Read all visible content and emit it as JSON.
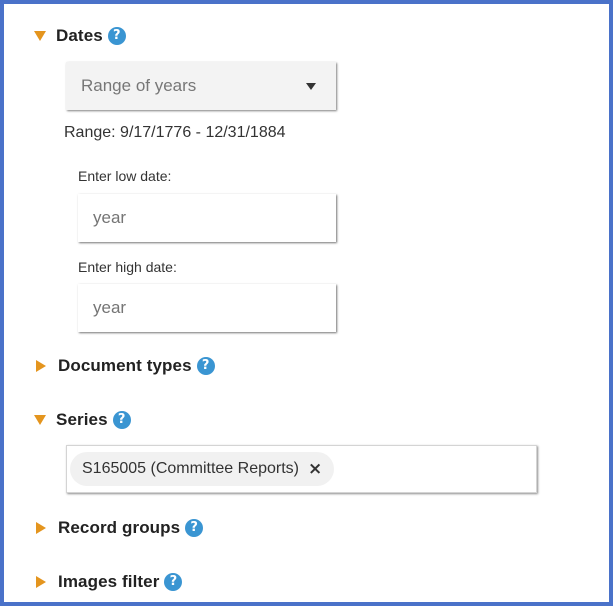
{
  "dates": {
    "title": "Dates",
    "range_select": {
      "value": "Range of years"
    },
    "range_text": "Range: 9/17/1776 - 12/31/1884",
    "low": {
      "label": "Enter low date:",
      "placeholder": "year"
    },
    "high": {
      "label": "Enter high date:",
      "placeholder": "year"
    }
  },
  "document_types": {
    "title": "Document types"
  },
  "series": {
    "title": "Series",
    "chip_label": "S165005 (Committee Reports)",
    "chip_remove": "×"
  },
  "record_groups": {
    "title": "Record groups"
  },
  "images_filter": {
    "title": "Images filter"
  },
  "icons": {
    "help": "?",
    "expanded": "triangle-down-icon",
    "collapsed": "triangle-right-icon"
  },
  "colors": {
    "frame_border": "#4a72c9",
    "triangle": "#e4951e",
    "help_icon": "#3a95d2"
  }
}
